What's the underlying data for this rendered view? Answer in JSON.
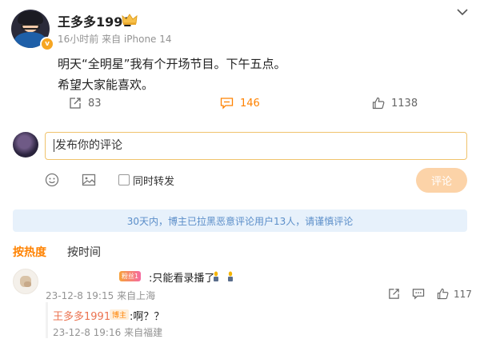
{
  "post": {
    "username": "王多多1991",
    "verified_mark": "v",
    "time": "16小时前",
    "source": "来自 iPhone 14",
    "line1": "明天“全明星”我有个开场节目。下午五点。",
    "line2": "希望大家能喜欢。",
    "share_count": "83",
    "comment_count": "146",
    "like_count": "1138",
    "accent_color": "#ff8200"
  },
  "composer": {
    "placeholder": "发布你的评论",
    "repost_label": "同时转发",
    "repost_checked": false,
    "submit_label": "评论"
  },
  "notice": "30天内，博主已拉黑恶意评论用户13人，请谨慎评论",
  "tabs": {
    "hot": "按热度",
    "time": "按时间"
  },
  "comments": [
    {
      "badge": "粉丝1",
      "text": ":只能看录播了",
      "time": "23-12-8 19:15",
      "source": "来自上海",
      "like_count": "117",
      "reply": {
        "username": "王多多1991",
        "owner_badge": "博主",
        "text": ":啊？？",
        "time": "23-12-8 19:16",
        "source": "来自福建"
      }
    }
  ],
  "icons": [
    "chevron-down-icon",
    "share-icon",
    "comment-icon",
    "like-icon",
    "emoji-icon",
    "image-icon",
    "crown-icon",
    "candle-emoji"
  ]
}
